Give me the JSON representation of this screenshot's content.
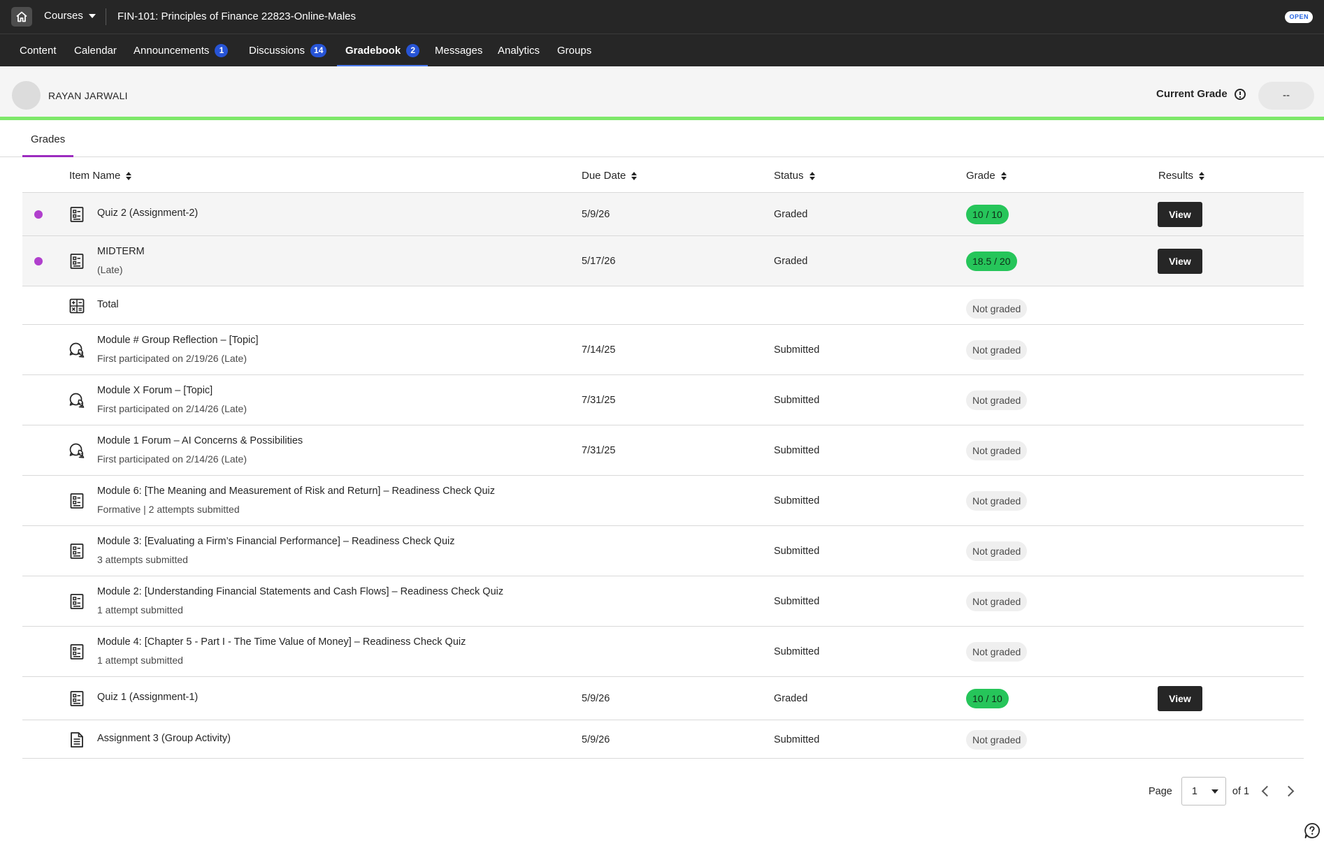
{
  "topbar": {
    "courses_label": "Courses",
    "course_title": "FIN-101: Principles of Finance 22823-Online-Males",
    "status_badge": "OPEN"
  },
  "nav": [
    {
      "label": "Content",
      "badge": ""
    },
    {
      "label": "Calendar",
      "badge": ""
    },
    {
      "label": "Announcements",
      "badge": "1"
    },
    {
      "label": "Discussions",
      "badge": "14"
    },
    {
      "label": "Gradebook",
      "badge": "2",
      "active": true
    },
    {
      "label": "Messages",
      "badge": ""
    },
    {
      "label": "Analytics",
      "badge": ""
    },
    {
      "label": "Groups",
      "badge": ""
    }
  ],
  "student": {
    "name": "RAYAN JARWALI",
    "current_grade_label": "Current Grade",
    "current_grade_value": "--"
  },
  "tabs": {
    "grades": "Grades"
  },
  "table": {
    "columns": {
      "item_name": "Item Name",
      "due_date": "Due Date",
      "status": "Status",
      "grade": "Grade",
      "results": "Results"
    },
    "rows": [
      {
        "icon": "quiz-icon",
        "title": "Quiz 2 (Assignment-2)",
        "subtitle": "",
        "due": "5/9/26",
        "status": "Graded",
        "grade": "10 / 10",
        "graded": true,
        "result": "View",
        "new": true
      },
      {
        "icon": "quiz-icon",
        "title": "MIDTERM",
        "subtitle": "(Late)",
        "due": "5/17/26",
        "status": "Graded",
        "grade": "18.5 / 20",
        "graded": true,
        "result": "View",
        "new": true
      },
      {
        "icon": "calculator-icon",
        "title": "Total",
        "subtitle": "",
        "due": "",
        "status": "",
        "grade": "Not graded",
        "graded": false,
        "result": "",
        "new": false
      },
      {
        "icon": "discussion-icon",
        "title": "Module # Group Reflection – [Topic]",
        "subtitle": "First participated on 2/19/26 (Late)",
        "due": "7/14/25",
        "status": "Submitted",
        "grade": "Not graded",
        "graded": false,
        "result": "",
        "new": false
      },
      {
        "icon": "discussion-icon",
        "title": "Module X Forum – [Topic]",
        "subtitle": "First participated on 2/14/26 (Late)",
        "due": "7/31/25",
        "status": "Submitted",
        "grade": "Not graded",
        "graded": false,
        "result": "",
        "new": false
      },
      {
        "icon": "discussion-icon",
        "title": "Module 1 Forum – AI Concerns & Possibilities",
        "subtitle": "First participated on 2/14/26 (Late)",
        "due": "7/31/25",
        "status": "Submitted",
        "grade": "Not graded",
        "graded": false,
        "result": "",
        "new": false
      },
      {
        "icon": "quiz-icon",
        "title": "Module 6: [The Meaning and Measurement of Risk and Return] – Readiness Check Quiz",
        "subtitle": "Formative | 2 attempts submitted",
        "due": "",
        "status": "Submitted",
        "grade": "Not graded",
        "graded": false,
        "result": "",
        "new": false
      },
      {
        "icon": "quiz-icon",
        "title": "Module 3: [Evaluating a Firm’s Financial Performance] – Readiness Check Quiz",
        "subtitle": "3 attempts submitted",
        "due": "",
        "status": "Submitted",
        "grade": "Not graded",
        "graded": false,
        "result": "",
        "new": false
      },
      {
        "icon": "quiz-icon",
        "title": "Module 2: [Understanding Financial Statements and Cash Flows] – Readiness Check Quiz",
        "subtitle": "1 attempt submitted",
        "due": "",
        "status": "Submitted",
        "grade": "Not graded",
        "graded": false,
        "result": "",
        "new": false
      },
      {
        "icon": "quiz-icon",
        "title": "Module 4: [Chapter 5 - Part I - The Time Value of Money] – Readiness Check Quiz",
        "subtitle": "1 attempt submitted",
        "due": "",
        "status": "Submitted",
        "grade": "Not graded",
        "graded": false,
        "result": "",
        "new": false
      },
      {
        "icon": "quiz-icon",
        "title": "Quiz 1 (Assignment-1)",
        "subtitle": "",
        "due": "5/9/26",
        "status": "Graded",
        "grade": "10 / 10",
        "graded": true,
        "result": "View",
        "new": false
      },
      {
        "icon": "document-icon",
        "title": "Assignment 3 (Group Activity)",
        "subtitle": "",
        "due": "5/9/26",
        "status": "Submitted",
        "grade": "Not graded",
        "graded": false,
        "result": "",
        "new": false
      }
    ]
  },
  "pagination": {
    "page_label": "Page",
    "current_page": "1",
    "of_label": "of 1"
  }
}
